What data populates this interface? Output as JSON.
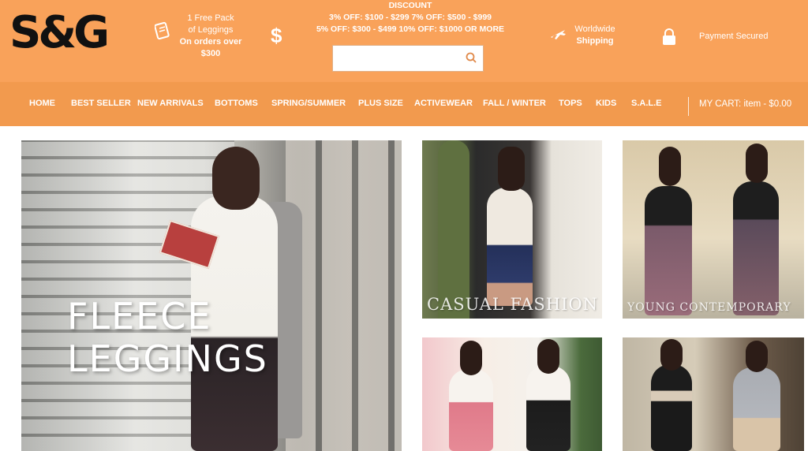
{
  "brand": {
    "logo": "S&G"
  },
  "promo": {
    "leggings_lines": [
      "1 Free Pack",
      "of Leggings"
    ],
    "leggings_bold": "On orders over $300",
    "dollar_icon": "dollar-icon",
    "discount_title": "DISCOUNT",
    "discount_row1": "3% OFF: $100 - $299    7% OFF: $500 - $999",
    "discount_row2": "5% OFF: $300 - $499    10% OFF: $1000 OR MORE"
  },
  "search": {
    "placeholder": "",
    "value": ""
  },
  "shipping": {
    "line1": "Worldwide",
    "line2": "Shipping"
  },
  "payment": {
    "label": "Payment Secured"
  },
  "nav": {
    "items": [
      "HOME",
      "BEST SELLER",
      "NEW ARRIVALS",
      "BOTTOMS",
      "SPRING/SUMMER",
      "PLUS SIZE",
      "ACTIVEWEAR",
      "FALL / WINTER",
      "TOPS",
      "KIDS",
      "S.A.L.E"
    ]
  },
  "cart": {
    "label": "MY CART:",
    "summary": "item - $0.00"
  },
  "banners": {
    "hero_title": "FLEECE LEGGINGS",
    "casual_title": "CASUAL FASHION",
    "young_title": "YOUNG CONTEMPORARY"
  },
  "colors": {
    "header_bg": "#f9a25a",
    "nav_bg": "#f29a4e",
    "text_on_header": "#ffffff"
  }
}
